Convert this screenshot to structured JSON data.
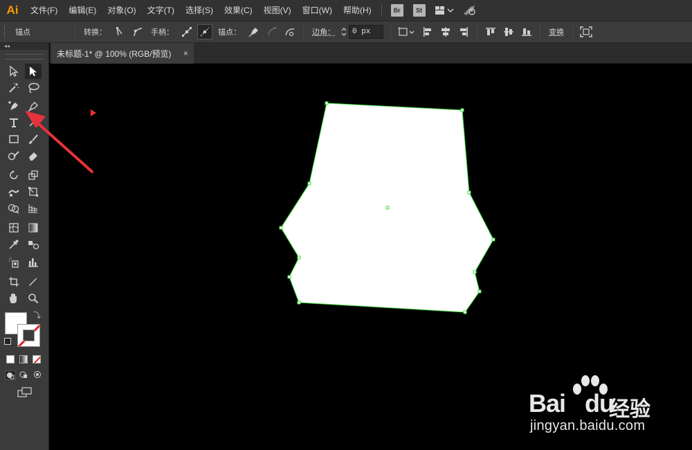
{
  "app": {
    "logo": "Ai"
  },
  "menu": {
    "items": [
      "文件(F)",
      "编辑(E)",
      "对象(O)",
      "文字(T)",
      "选择(S)",
      "效果(C)",
      "视图(V)",
      "窗口(W)",
      "帮助(H)"
    ],
    "bridge_badge": "Br",
    "stock_badge": "St"
  },
  "controlbar": {
    "context_label": "锚点",
    "convert_label": "转换：",
    "handles_label": "手柄：",
    "anchors_label": "锚点：",
    "corner_label": "边角",
    "corner_colon": "：",
    "corner_value": "0 px",
    "transform_label": "变换"
  },
  "document": {
    "tab_title": "未标题-1* @ 100% (RGB/预览)",
    "tab_close": "×"
  },
  "colors": {
    "accent_orange": "#ff9a00",
    "selection_green": "#3cdc3c",
    "annotation_red": "#e8323a",
    "fill": "#ffffff"
  },
  "watermark": {
    "brand": "Bai",
    "brand_suffix": "du",
    "cn": "经验",
    "url": "jingyan.baidu.com"
  }
}
